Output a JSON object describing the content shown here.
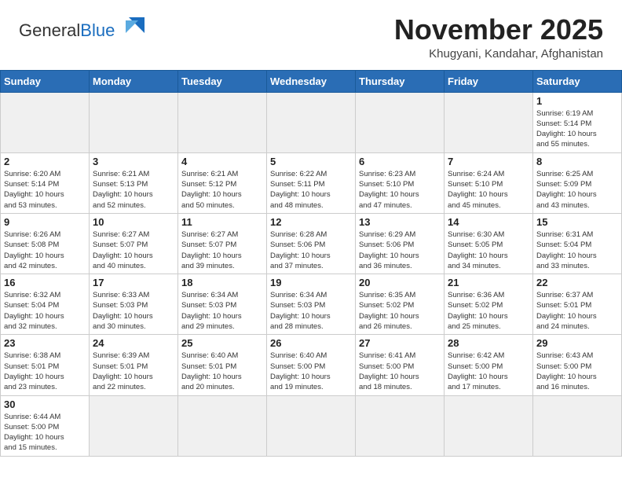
{
  "header": {
    "logo_general": "General",
    "logo_blue": "Blue",
    "month_title": "November 2025",
    "location": "Khugyani, Kandahar, Afghanistan"
  },
  "weekdays": [
    "Sunday",
    "Monday",
    "Tuesday",
    "Wednesday",
    "Thursday",
    "Friday",
    "Saturday"
  ],
  "weeks": [
    [
      {
        "day": "",
        "info": ""
      },
      {
        "day": "",
        "info": ""
      },
      {
        "day": "",
        "info": ""
      },
      {
        "day": "",
        "info": ""
      },
      {
        "day": "",
        "info": ""
      },
      {
        "day": "",
        "info": ""
      },
      {
        "day": "1",
        "info": "Sunrise: 6:19 AM\nSunset: 5:14 PM\nDaylight: 10 hours\nand 55 minutes."
      }
    ],
    [
      {
        "day": "2",
        "info": "Sunrise: 6:20 AM\nSunset: 5:14 PM\nDaylight: 10 hours\nand 53 minutes."
      },
      {
        "day": "3",
        "info": "Sunrise: 6:21 AM\nSunset: 5:13 PM\nDaylight: 10 hours\nand 52 minutes."
      },
      {
        "day": "4",
        "info": "Sunrise: 6:21 AM\nSunset: 5:12 PM\nDaylight: 10 hours\nand 50 minutes."
      },
      {
        "day": "5",
        "info": "Sunrise: 6:22 AM\nSunset: 5:11 PM\nDaylight: 10 hours\nand 48 minutes."
      },
      {
        "day": "6",
        "info": "Sunrise: 6:23 AM\nSunset: 5:10 PM\nDaylight: 10 hours\nand 47 minutes."
      },
      {
        "day": "7",
        "info": "Sunrise: 6:24 AM\nSunset: 5:10 PM\nDaylight: 10 hours\nand 45 minutes."
      },
      {
        "day": "8",
        "info": "Sunrise: 6:25 AM\nSunset: 5:09 PM\nDaylight: 10 hours\nand 43 minutes."
      }
    ],
    [
      {
        "day": "9",
        "info": "Sunrise: 6:26 AM\nSunset: 5:08 PM\nDaylight: 10 hours\nand 42 minutes."
      },
      {
        "day": "10",
        "info": "Sunrise: 6:27 AM\nSunset: 5:07 PM\nDaylight: 10 hours\nand 40 minutes."
      },
      {
        "day": "11",
        "info": "Sunrise: 6:27 AM\nSunset: 5:07 PM\nDaylight: 10 hours\nand 39 minutes."
      },
      {
        "day": "12",
        "info": "Sunrise: 6:28 AM\nSunset: 5:06 PM\nDaylight: 10 hours\nand 37 minutes."
      },
      {
        "day": "13",
        "info": "Sunrise: 6:29 AM\nSunset: 5:06 PM\nDaylight: 10 hours\nand 36 minutes."
      },
      {
        "day": "14",
        "info": "Sunrise: 6:30 AM\nSunset: 5:05 PM\nDaylight: 10 hours\nand 34 minutes."
      },
      {
        "day": "15",
        "info": "Sunrise: 6:31 AM\nSunset: 5:04 PM\nDaylight: 10 hours\nand 33 minutes."
      }
    ],
    [
      {
        "day": "16",
        "info": "Sunrise: 6:32 AM\nSunset: 5:04 PM\nDaylight: 10 hours\nand 32 minutes."
      },
      {
        "day": "17",
        "info": "Sunrise: 6:33 AM\nSunset: 5:03 PM\nDaylight: 10 hours\nand 30 minutes."
      },
      {
        "day": "18",
        "info": "Sunrise: 6:34 AM\nSunset: 5:03 PM\nDaylight: 10 hours\nand 29 minutes."
      },
      {
        "day": "19",
        "info": "Sunrise: 6:34 AM\nSunset: 5:03 PM\nDaylight: 10 hours\nand 28 minutes."
      },
      {
        "day": "20",
        "info": "Sunrise: 6:35 AM\nSunset: 5:02 PM\nDaylight: 10 hours\nand 26 minutes."
      },
      {
        "day": "21",
        "info": "Sunrise: 6:36 AM\nSunset: 5:02 PM\nDaylight: 10 hours\nand 25 minutes."
      },
      {
        "day": "22",
        "info": "Sunrise: 6:37 AM\nSunset: 5:01 PM\nDaylight: 10 hours\nand 24 minutes."
      }
    ],
    [
      {
        "day": "23",
        "info": "Sunrise: 6:38 AM\nSunset: 5:01 PM\nDaylight: 10 hours\nand 23 minutes."
      },
      {
        "day": "24",
        "info": "Sunrise: 6:39 AM\nSunset: 5:01 PM\nDaylight: 10 hours\nand 22 minutes."
      },
      {
        "day": "25",
        "info": "Sunrise: 6:40 AM\nSunset: 5:01 PM\nDaylight: 10 hours\nand 20 minutes."
      },
      {
        "day": "26",
        "info": "Sunrise: 6:40 AM\nSunset: 5:00 PM\nDaylight: 10 hours\nand 19 minutes."
      },
      {
        "day": "27",
        "info": "Sunrise: 6:41 AM\nSunset: 5:00 PM\nDaylight: 10 hours\nand 18 minutes."
      },
      {
        "day": "28",
        "info": "Sunrise: 6:42 AM\nSunset: 5:00 PM\nDaylight: 10 hours\nand 17 minutes."
      },
      {
        "day": "29",
        "info": "Sunrise: 6:43 AM\nSunset: 5:00 PM\nDaylight: 10 hours\nand 16 minutes."
      }
    ],
    [
      {
        "day": "30",
        "info": "Sunrise: 6:44 AM\nSunset: 5:00 PM\nDaylight: 10 hours\nand 15 minutes."
      },
      {
        "day": "",
        "info": ""
      },
      {
        "day": "",
        "info": ""
      },
      {
        "day": "",
        "info": ""
      },
      {
        "day": "",
        "info": ""
      },
      {
        "day": "",
        "info": ""
      },
      {
        "day": "",
        "info": ""
      }
    ]
  ]
}
